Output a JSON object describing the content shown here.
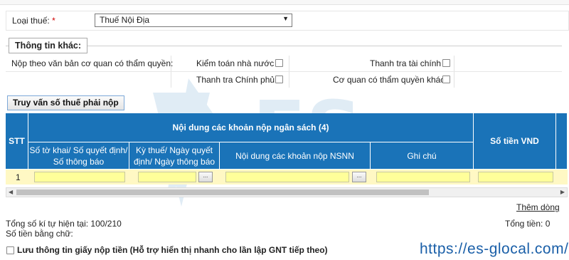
{
  "tax_type": {
    "label": "Loại thuế:",
    "required_mark": "*",
    "selected": "Thuế Nội Địa"
  },
  "other_info": {
    "legend": "Thông tin khác:",
    "authority_label": "Nộp theo văn bản cơ quan có thẩm quyền:",
    "options": [
      {
        "label": "Kiểm toán nhà nước",
        "checked": false
      },
      {
        "label": "Thanh tra tài chính",
        "checked": false
      },
      {
        "label": "Thanh tra Chính phủ",
        "checked": false
      },
      {
        "label": "Cơ quan có thẩm quyền khác",
        "checked": false
      }
    ]
  },
  "query_button": "Truy vấn số thuế phải nộp",
  "table": {
    "headers": {
      "stt": "STT",
      "group": "Nội dung các khoản nộp ngân sách (4)",
      "amount": "Số tiền VND",
      "declaration": "Số tờ khai/ Số quyết định/ Số thông báo",
      "period": "Kỳ thuế/ Ngày quyết định/ Ngày thông báo",
      "nsnn_content": "Nội dung các khoản nộp NSNN",
      "note": "Ghi chú"
    },
    "rows": [
      {
        "stt": "1",
        "picker_label": "..."
      }
    ]
  },
  "add_row_link": "Thêm dòng",
  "char_count": "Tổng số kí tự hiện tại: 100/210",
  "total": "Tổng tiền: 0",
  "amount_in_words": "Số tiền bằng chữ:",
  "save_info": {
    "label": "Lưu thông tin giấy nộp tiền (Hỗ trợ hiển thị nhanh cho lần lập GNT tiếp theo)",
    "checked": false
  },
  "watermark_url": "https://es-glocal.com/",
  "colors": {
    "header_blue": "#1a73b8",
    "input_yellow": "#ffff9a",
    "required_red": "#d00000"
  }
}
